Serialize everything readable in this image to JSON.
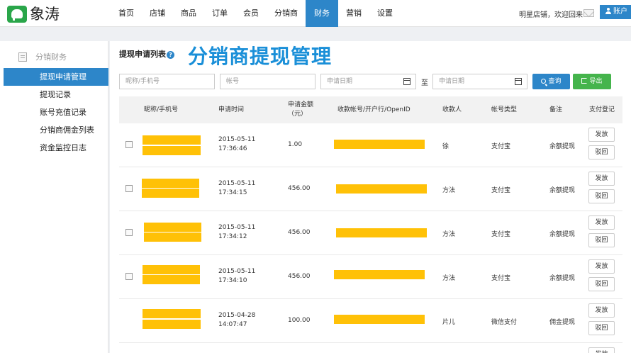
{
  "brand": {
    "name": "象涛",
    "logo_icon": "elephant-icon"
  },
  "nav": [
    "首页",
    "店铺",
    "商品",
    "订单",
    "会员",
    "分销商",
    "财务",
    "营销",
    "设置"
  ],
  "nav_active": "财务",
  "header": {
    "welcome": "明星店铺，欢迎回来",
    "account_label": "账户"
  },
  "sidebar": {
    "section": "分销财务",
    "items": [
      "提现申请管理",
      "提现记录",
      "账号充值记录",
      "分销商佣金列表",
      "资金监控日志"
    ],
    "active": "提现申请管理"
  },
  "page": {
    "subtitle": "提现申请列表",
    "title": "分销商提现管理"
  },
  "filters": {
    "nickname_placeholder": "昵称/手机号",
    "account_placeholder": "帐号",
    "date_start_placeholder": "申请日期",
    "date_to": "至",
    "date_end_placeholder": "申请日期",
    "query_label": "查询",
    "export_label": "导出"
  },
  "table": {
    "headers": [
      "昵称/手机号",
      "申请时间",
      "申请金额（元）",
      "收款帐号/开户行/OpenID",
      "收款人",
      "帐号类型",
      "备注",
      "支付登记"
    ],
    "action_send": "发放",
    "action_reject": "驳回",
    "rows": [
      {
        "date": "2015-05-11",
        "time": "17:36:46",
        "amount": "1.00",
        "payee": "徐",
        "type": "支付宝",
        "note": "余额提现"
      },
      {
        "date": "2015-05-11",
        "time": "17:34:15",
        "amount": "456.00",
        "payee": "方法",
        "type": "支付宝",
        "note": "余额提现"
      },
      {
        "date": "2015-05-11",
        "time": "17:34:12",
        "amount": "456.00",
        "payee": "方法",
        "type": "支付宝",
        "note": "余额提现"
      },
      {
        "date": "2015-05-11",
        "time": "17:34:10",
        "amount": "456.00",
        "payee": "方法",
        "type": "支付宝",
        "note": "余额提现"
      },
      {
        "date": "2015-04-28",
        "time": "14:07:47",
        "amount": "100.00",
        "payee": "片儿",
        "type": "微信支付",
        "note": "佣金提现"
      }
    ]
  },
  "colors": {
    "primary": "#2d86c9",
    "success": "#45b44c",
    "redaction": "#ffc107",
    "title": "#1a8fd8"
  }
}
